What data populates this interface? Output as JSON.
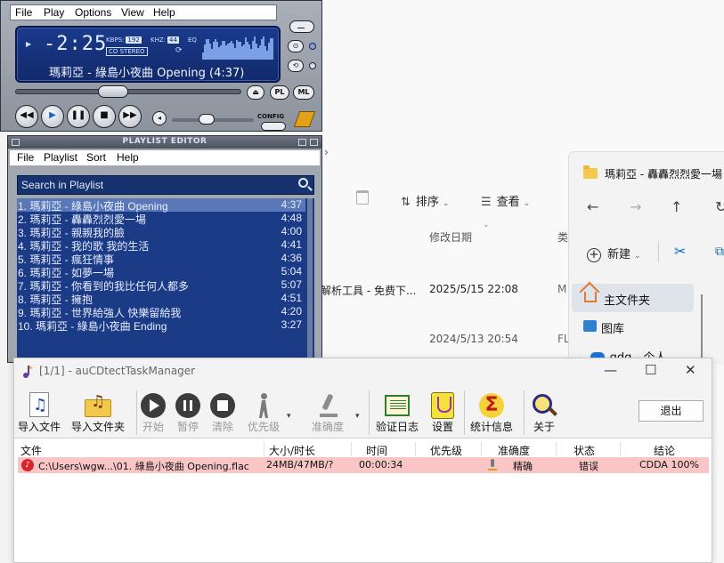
{
  "explorer": {
    "toolbar": {
      "sort_label": "排序",
      "view_label": "查看"
    },
    "columns": {
      "modified": "修改日期",
      "type_partial": "类"
    },
    "rows": [
      {
        "name_partial": "解析工具 - 免费下...",
        "date": "2025/5/15 22:08",
        "type_partial": "M"
      },
      {
        "name_partial": "",
        "date": "2024/5/13 20:54",
        "type_partial": "FL"
      }
    ],
    "pane": {
      "title": "瑪莉亞 - 轟轟烈烈愛一場",
      "new_label": "新建",
      "home_label": "主文件夹",
      "gallery_label": "图库",
      "onedrive_label": "gdg - 个人"
    }
  },
  "winamp": {
    "menu": {
      "file": "File",
      "play": "Play",
      "options": "Options",
      "view": "View",
      "help": "Help"
    },
    "time": "-2:25",
    "kbps_label": "KBPS:",
    "kbps": "192",
    "khz_label": "KHZ:",
    "khz": "44",
    "eq_label": "EQ",
    "stereo": "CO STEREO",
    "now_playing": "瑪莉亞 - 綠島小夜曲 Opening (4:37)",
    "seek_fraction": 0.42,
    "volume_fraction": 0.4,
    "pl_button": "PL",
    "ml_button": "ML",
    "config_label": "CONFIG"
  },
  "playlist": {
    "title": "PLAYLIST EDITOR",
    "menu": {
      "file": "File",
      "playlist": "Playlist",
      "sort": "Sort",
      "help": "Help"
    },
    "search_placeholder": "Search in Playlist",
    "tracks": [
      {
        "title": "1. 瑪莉亞 - 綠島小夜曲 Opening",
        "duration": "4:37",
        "selected": true
      },
      {
        "title": "2. 瑪莉亞 - 轟轟烈烈愛一場",
        "duration": "4:48"
      },
      {
        "title": "3. 瑪莉亞 - 親親我的臉",
        "duration": "4:00"
      },
      {
        "title": "4. 瑪莉亞 - 我的歌 我的生活",
        "duration": "4:41"
      },
      {
        "title": "5. 瑪莉亞 - 瘋狂情事",
        "duration": "4:36"
      },
      {
        "title": "6. 瑪莉亞 - 如夢一場",
        "duration": "5:04"
      },
      {
        "title": "7. 瑪莉亞 - 你看到的我比任何人都多",
        "duration": "5:07"
      },
      {
        "title": "8. 瑪莉亞 - 擁抱",
        "duration": "4:51"
      },
      {
        "title": "9. 瑪莉亞 - 世界給強人 快樂留給我",
        "duration": "4:20"
      },
      {
        "title": "10. 瑪莉亞 - 綠島小夜曲 Ending",
        "duration": "3:27"
      }
    ]
  },
  "aucdtect": {
    "title": "[1/1] - auCDtectTaskManager",
    "toolbar": {
      "import_file": "导入文件",
      "import_folder": "导入文件夹",
      "start": "开始",
      "pause": "暂停",
      "clear": "清除",
      "priority": "优先级",
      "accuracy": "准确度",
      "verify_log": "验证日志",
      "settings": "设置",
      "statistics": "统计信息",
      "about": "关于",
      "exit": "退出"
    },
    "columns": {
      "file": "文件",
      "size": "大小/时长",
      "time": "时间",
      "priority": "优先级",
      "accuracy": "准确度",
      "status": "状态",
      "conclusion": "结论"
    },
    "rows": [
      {
        "file": "C:\\Users\\wgw...\\01. 綠島小夜曲 Opening.flac",
        "size": "24MB/47MB/?",
        "time": "00:00:34",
        "priority": "",
        "accuracy": "精确",
        "status": "错误",
        "conclusion": "CDDA 100%"
      }
    ]
  }
}
